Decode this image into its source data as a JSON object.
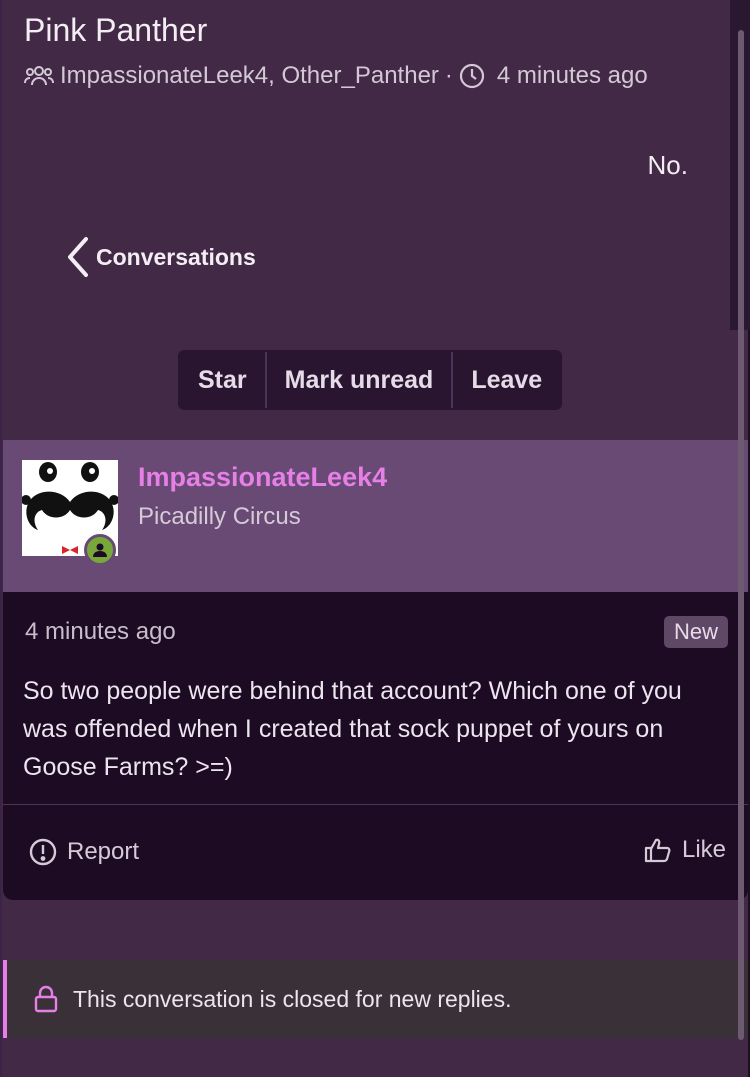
{
  "conversation": {
    "title": "Pink Panther",
    "participants": "ImpassionateLeek4, Other_Panther",
    "separator": "·",
    "time": "4 minutes ago",
    "last_message_preview": "No."
  },
  "nav": {
    "back_label": "Conversations"
  },
  "actions": {
    "star": "Star",
    "mark_unread": "Mark unread",
    "leave": "Leave"
  },
  "message": {
    "author": "ImpassionateLeek4",
    "location": "Picadilly Circus",
    "time": "4 minutes ago",
    "badge": "New",
    "body": "So two people were behind that account? Which one of you was offended when I created that sock puppet of yours on Goose Farms? >=)",
    "report_label": "Report",
    "like_label": "Like"
  },
  "closed_notice": "This conversation is closed for new replies.",
  "colors": {
    "accent": "#e67fe6",
    "panel": "#422a46",
    "message_bg": "#1c0b22",
    "author_bg": "#684a74",
    "online": "#78a83a"
  },
  "icons": [
    "users-icon",
    "clock-icon",
    "chevron-left-icon",
    "alert-circle-icon",
    "thumbs-up-icon",
    "lock-icon"
  ]
}
